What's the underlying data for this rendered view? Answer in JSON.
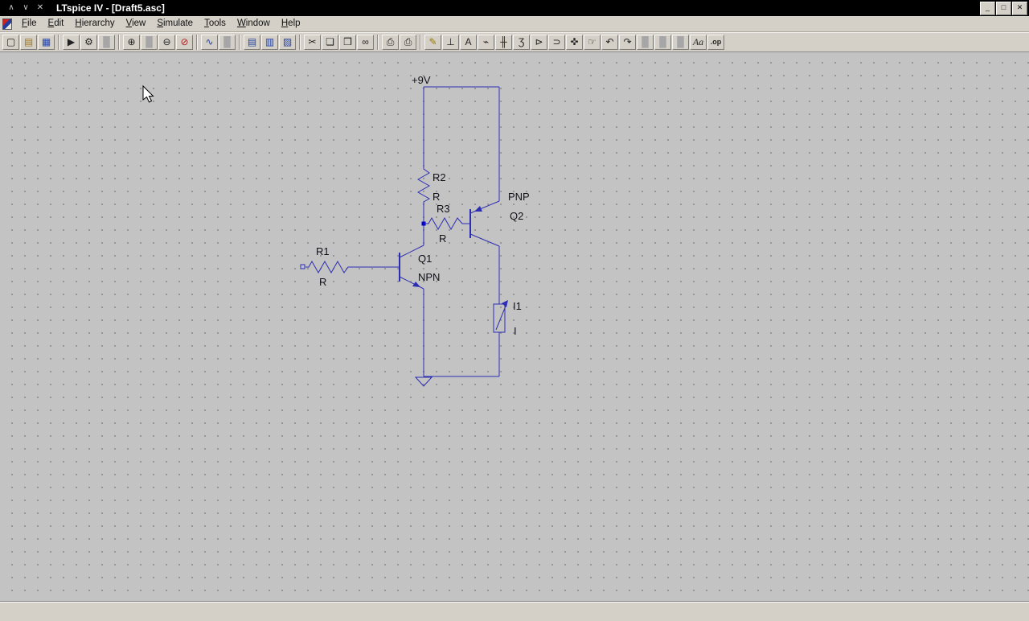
{
  "window": {
    "title": "LTspice IV - [Draft5.asc]",
    "left_controls": {
      "shade": "∧",
      "unshade": "∨",
      "close": "✕"
    },
    "right_controls": {
      "minimize": "_",
      "maximize": "□",
      "close": "✕"
    }
  },
  "menu": {
    "items": [
      "File",
      "Edit",
      "Hierarchy",
      "View",
      "Simulate",
      "Tools",
      "Window",
      "Help"
    ]
  },
  "toolbar": {
    "icons": [
      {
        "name": "new-schematic",
        "glyph": "▢"
      },
      {
        "name": "open-file",
        "glyph": "▤"
      },
      {
        "name": "save",
        "glyph": "▦"
      },
      {
        "name": "run",
        "glyph": "▶"
      },
      {
        "name": "control-panel",
        "glyph": "⚙"
      },
      {
        "name": "halt",
        "glyph": "█"
      },
      {
        "name": "zoom-area",
        "glyph": "⊕"
      },
      {
        "name": "zoom-back",
        "glyph": "█"
      },
      {
        "name": "zoom-out",
        "glyph": "⊖"
      },
      {
        "name": "zoom-full-extents",
        "glyph": "⊘"
      },
      {
        "name": "autorange-y-axis",
        "glyph": "∿"
      },
      {
        "name": "inactive-tool-1",
        "glyph": "█"
      },
      {
        "name": "tile-horizontal",
        "glyph": "▤"
      },
      {
        "name": "tile-vertical",
        "glyph": "▥"
      },
      {
        "name": "cascade-windows",
        "glyph": "▨"
      },
      {
        "name": "cut",
        "glyph": "✂"
      },
      {
        "name": "copy",
        "glyph": "❏"
      },
      {
        "name": "paste",
        "glyph": "❒"
      },
      {
        "name": "find",
        "glyph": "∞"
      },
      {
        "name": "print-preview",
        "glyph": "⎙"
      },
      {
        "name": "print",
        "glyph": "⎙"
      },
      {
        "name": "draw-wire",
        "glyph": "✎"
      },
      {
        "name": "place-ground",
        "glyph": "⊥"
      },
      {
        "name": "place-net-label",
        "glyph": "A"
      },
      {
        "name": "place-resistor",
        "glyph": "⌁"
      },
      {
        "name": "place-capacitor",
        "glyph": "╫"
      },
      {
        "name": "place-inductor",
        "glyph": "Ʒ"
      },
      {
        "name": "place-diode",
        "glyph": "⊳"
      },
      {
        "name": "place-component",
        "glyph": "⊃"
      },
      {
        "name": "move",
        "glyph": "✜"
      },
      {
        "name": "drag",
        "glyph": "☞"
      },
      {
        "name": "undo",
        "glyph": "↶"
      },
      {
        "name": "redo",
        "glyph": "↷"
      },
      {
        "name": "rotate",
        "glyph": "█"
      },
      {
        "name": "mirror",
        "glyph": "█"
      },
      {
        "name": "inactive-tool-2",
        "glyph": "█"
      },
      {
        "name": "text-tool",
        "glyph": "Aa"
      },
      {
        "name": "spice-directive",
        "glyph": ".op"
      }
    ]
  },
  "schematic": {
    "labels": {
      "supply": "+9V",
      "r1_name": "R1",
      "r1_value": "R",
      "r2_name": "R2",
      "r2_value": "R",
      "r3_name": "R3",
      "r3_value": "R",
      "q1_name": "Q1",
      "q1_type": "NPN",
      "q2_name": "Q2",
      "q2_type": "PNP",
      "i1_name": "I1",
      "i1_value": "I"
    },
    "colors": {
      "wire": "#2d2db4",
      "junction": "#0000cc",
      "background": "#c3c3c3",
      "grid_dot": "#8f8f8f",
      "label_text": "#101018",
      "titlebar": "#000000",
      "chrome": "#d4d0c8"
    }
  }
}
